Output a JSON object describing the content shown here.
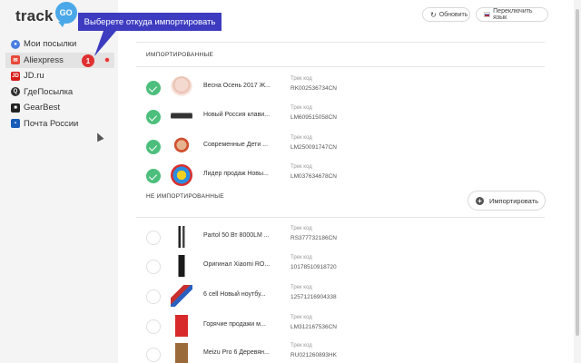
{
  "logo": {
    "text": "track",
    "bubble": "GO"
  },
  "sidebar": {
    "items": [
      {
        "label": "Мои посылки",
        "icon": "my-parcels-icon"
      },
      {
        "label": "Aliexpress",
        "icon": "aliexpress-icon"
      },
      {
        "label": "JD.ru",
        "icon": "jd-icon"
      },
      {
        "label": "ГдеПосылка",
        "icon": "gdeposylka-icon"
      },
      {
        "label": "GearBest",
        "icon": "gearbest-icon"
      },
      {
        "label": "Почта России",
        "icon": "russian-post-icon"
      }
    ]
  },
  "tooltip": {
    "text": "Выберете откуда импортировать",
    "badge": "1"
  },
  "header": {
    "refresh_label": "Обновить",
    "lang_label": "Переключить язык"
  },
  "sections": {
    "imported": "ИМПОРТИРОВАННЫЕ",
    "not_imported": "НЕ ИМПОРТИРОВАННЫЕ"
  },
  "import_button": "Импортировать",
  "track_label": "Трек код",
  "imported_rows": [
    {
      "name": "Весна Осень 2017 Ж...",
      "code": "RK002536734CN",
      "thumb": "dress-thumb"
    },
    {
      "name": "Новый Россия клави...",
      "code": "LM609515058CN",
      "thumb": "keyboard-thumb"
    },
    {
      "name": "Современные Дети ...",
      "code": "LM250091747CN",
      "thumb": "kids-thumb"
    },
    {
      "name": "Лидер продаж Новы...",
      "code": "LM037634678CN",
      "thumb": "toy-thumb"
    }
  ],
  "not_imported_rows": [
    {
      "name": "Partol 50 Вт 8000LM ...",
      "code": "RS377732186CN",
      "thumb": "lamp-thumb"
    },
    {
      "name": "Оригинал Xiaomi RO...",
      "code": "10178510918720",
      "thumb": "xiaomi-thumb"
    },
    {
      "name": "6 cell Новый ноутбу...",
      "code": "12571216904338",
      "thumb": "battery-thumb"
    },
    {
      "name": "Горячие продажи м...",
      "code": "LM312167536CN",
      "thumb": "case-thumb"
    },
    {
      "name": "Meizu Pro 6 Деревян...",
      "code": "RU021260893HK",
      "thumb": "wood-case-thumb"
    }
  ]
}
